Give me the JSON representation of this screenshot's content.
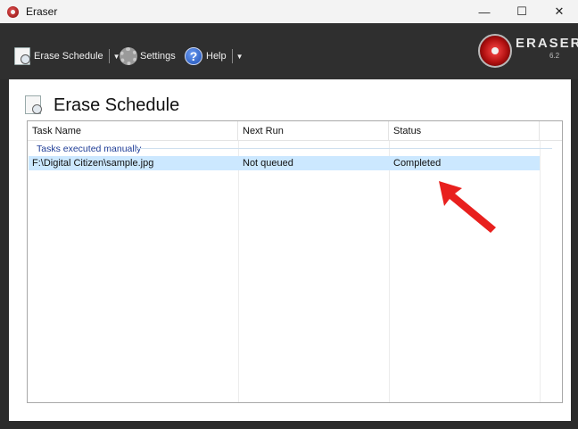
{
  "window": {
    "title": "Eraser",
    "controls": {
      "minimize": "—",
      "maximize": "☐",
      "close": "✕"
    }
  },
  "toolbar": {
    "erase_schedule": "Erase Schedule",
    "settings": "Settings",
    "help": "Help",
    "help_glyph": "?",
    "caret": "▼"
  },
  "logo": {
    "text": "ERASER",
    "version": "6.2"
  },
  "page": {
    "title": "Erase Schedule"
  },
  "table": {
    "columns": [
      "Task Name",
      "Next Run",
      "Status"
    ],
    "group_label": "Tasks executed manually",
    "rows": [
      {
        "task_name": "F:\\Digital Citizen\\sample.jpg",
        "next_run": "Not queued",
        "status": "Completed"
      }
    ]
  },
  "colors": {
    "toolbar_bg": "#2f2f2f",
    "selection": "#cce8ff",
    "arrow": "#e8201e",
    "group_text": "#1e3c96"
  }
}
